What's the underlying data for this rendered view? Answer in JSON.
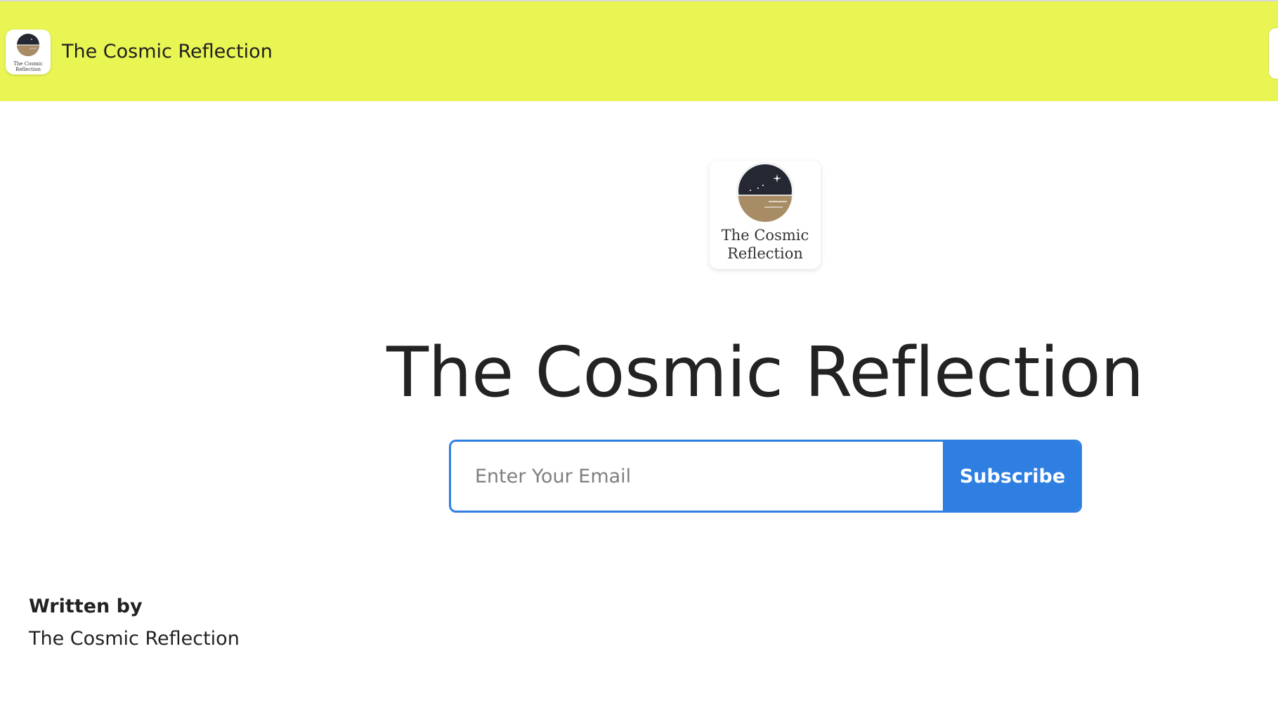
{
  "header": {
    "logo_text": [
      "The Cosmic",
      "Reflection"
    ],
    "title": "The Cosmic Reflection"
  },
  "hero": {
    "logo_text": [
      "The Cosmic",
      "Reflection"
    ],
    "title": "The Cosmic Reflection"
  },
  "subscribe": {
    "email_placeholder": "Enter Your Email",
    "button_label": "Subscribe"
  },
  "author": {
    "label": "Written by",
    "name": "The Cosmic Reflection"
  },
  "colors": {
    "header_background": "#e8f553",
    "accent": "#2f7fe2",
    "night_sky": "#252833",
    "sand": "#a88c66",
    "text": "#222222"
  },
  "icons": {
    "logo": "night-sky-horizon-icon"
  }
}
